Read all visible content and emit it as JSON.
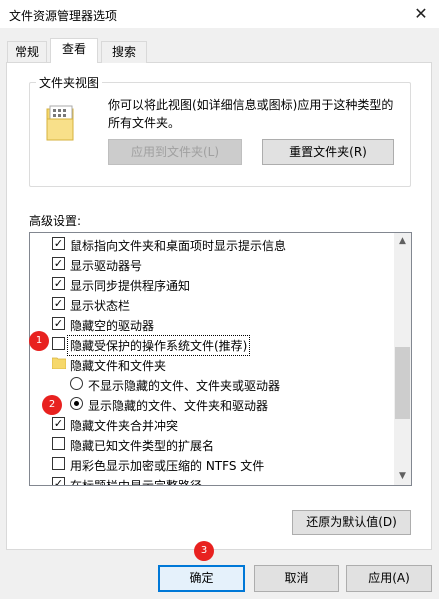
{
  "window": {
    "title": "文件资源管理器选项",
    "close_glyph": "✕"
  },
  "tabs": [
    {
      "label": "常规"
    },
    {
      "label": "查看"
    },
    {
      "label": "搜索"
    }
  ],
  "folder_views": {
    "group_label": "文件夹视图",
    "description": "你可以将此视图(如详细信息或图标)应用于这种类型的所有文件夹。",
    "apply_button": "应用到文件夹(L)",
    "reset_button": "重置文件夹(R)"
  },
  "advanced": {
    "label": "高级设置:",
    "items": [
      {
        "kind": "checkbox",
        "checked": true,
        "label": "鼠标指向文件夹和桌面项时显示提示信息"
      },
      {
        "kind": "checkbox",
        "checked": true,
        "label": "显示驱动器号"
      },
      {
        "kind": "checkbox",
        "checked": true,
        "label": "显示同步提供程序通知"
      },
      {
        "kind": "checkbox",
        "checked": true,
        "label": "显示状态栏"
      },
      {
        "kind": "checkbox",
        "checked": true,
        "label": "隐藏空的驱动器"
      },
      {
        "kind": "checkbox",
        "checked": false,
        "label": "隐藏受保护的操作系统文件(推荐)"
      },
      {
        "kind": "folder",
        "label": "隐藏文件和文件夹"
      },
      {
        "kind": "radio",
        "checked": false,
        "label": "不显示隐藏的文件、文件夹或驱动器"
      },
      {
        "kind": "radio",
        "checked": true,
        "label": "显示隐藏的文件、文件夹和驱动器"
      },
      {
        "kind": "checkbox",
        "checked": true,
        "label": "隐藏文件夹合并冲突"
      },
      {
        "kind": "checkbox",
        "checked": false,
        "label": "隐藏已知文件类型的扩展名"
      },
      {
        "kind": "checkbox",
        "checked": false,
        "label": "用彩色显示加密或压缩的 NTFS 文件"
      },
      {
        "kind": "checkbox",
        "checked": true,
        "label": "在标题栏中显示完整路径"
      }
    ],
    "scroll_position_fraction": 0.55,
    "restore_defaults_button": "还原为默认值(D)"
  },
  "footer": {
    "ok_button": "确定",
    "cancel_button": "取消",
    "apply_button": "应用(A)"
  },
  "callouts": [
    "1",
    "2",
    "3"
  ],
  "colors": {
    "callout": "#e8211f",
    "focus": "#0078d7"
  },
  "icons": {
    "check": "✓",
    "scroll_up": "▲",
    "scroll_down": "▼"
  }
}
